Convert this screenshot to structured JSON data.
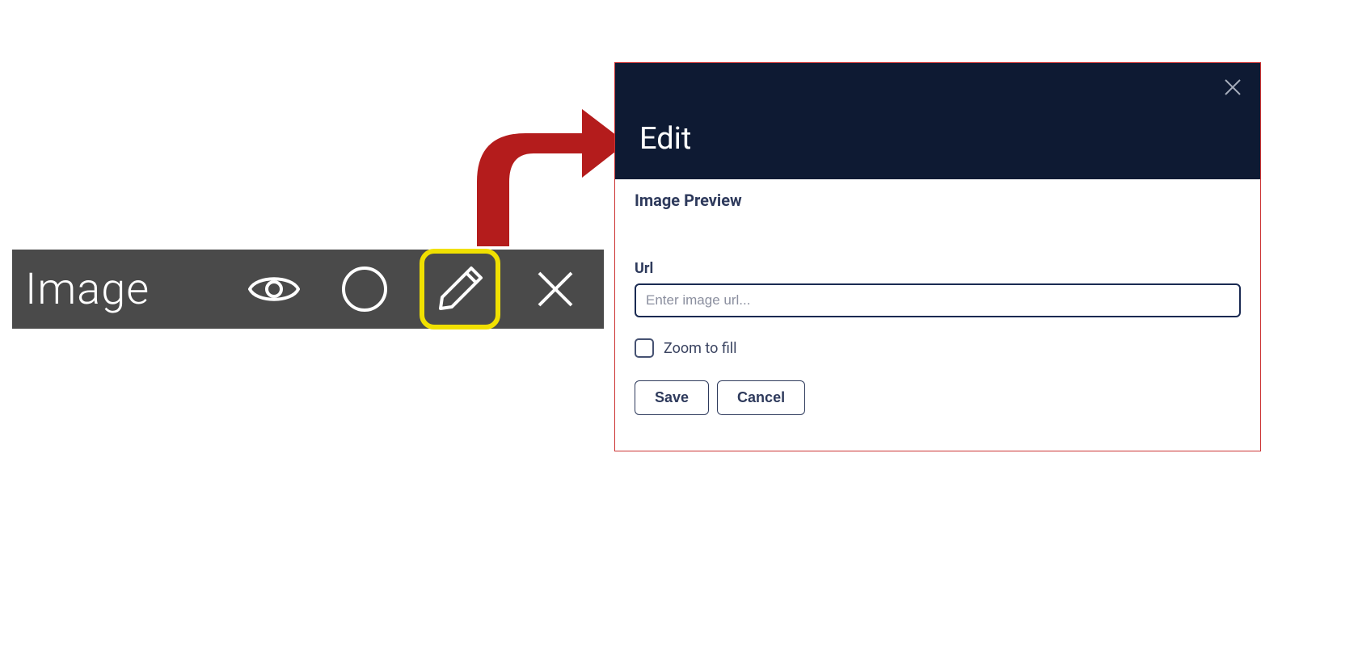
{
  "toolbar": {
    "label": "Image"
  },
  "modal": {
    "title": "Edit",
    "preview_label": "Image Preview",
    "url_label": "Url",
    "url_placeholder": "Enter image url...",
    "url_value": "",
    "zoom_label": "Zoom to fill",
    "save_label": "Save",
    "cancel_label": "Cancel"
  }
}
